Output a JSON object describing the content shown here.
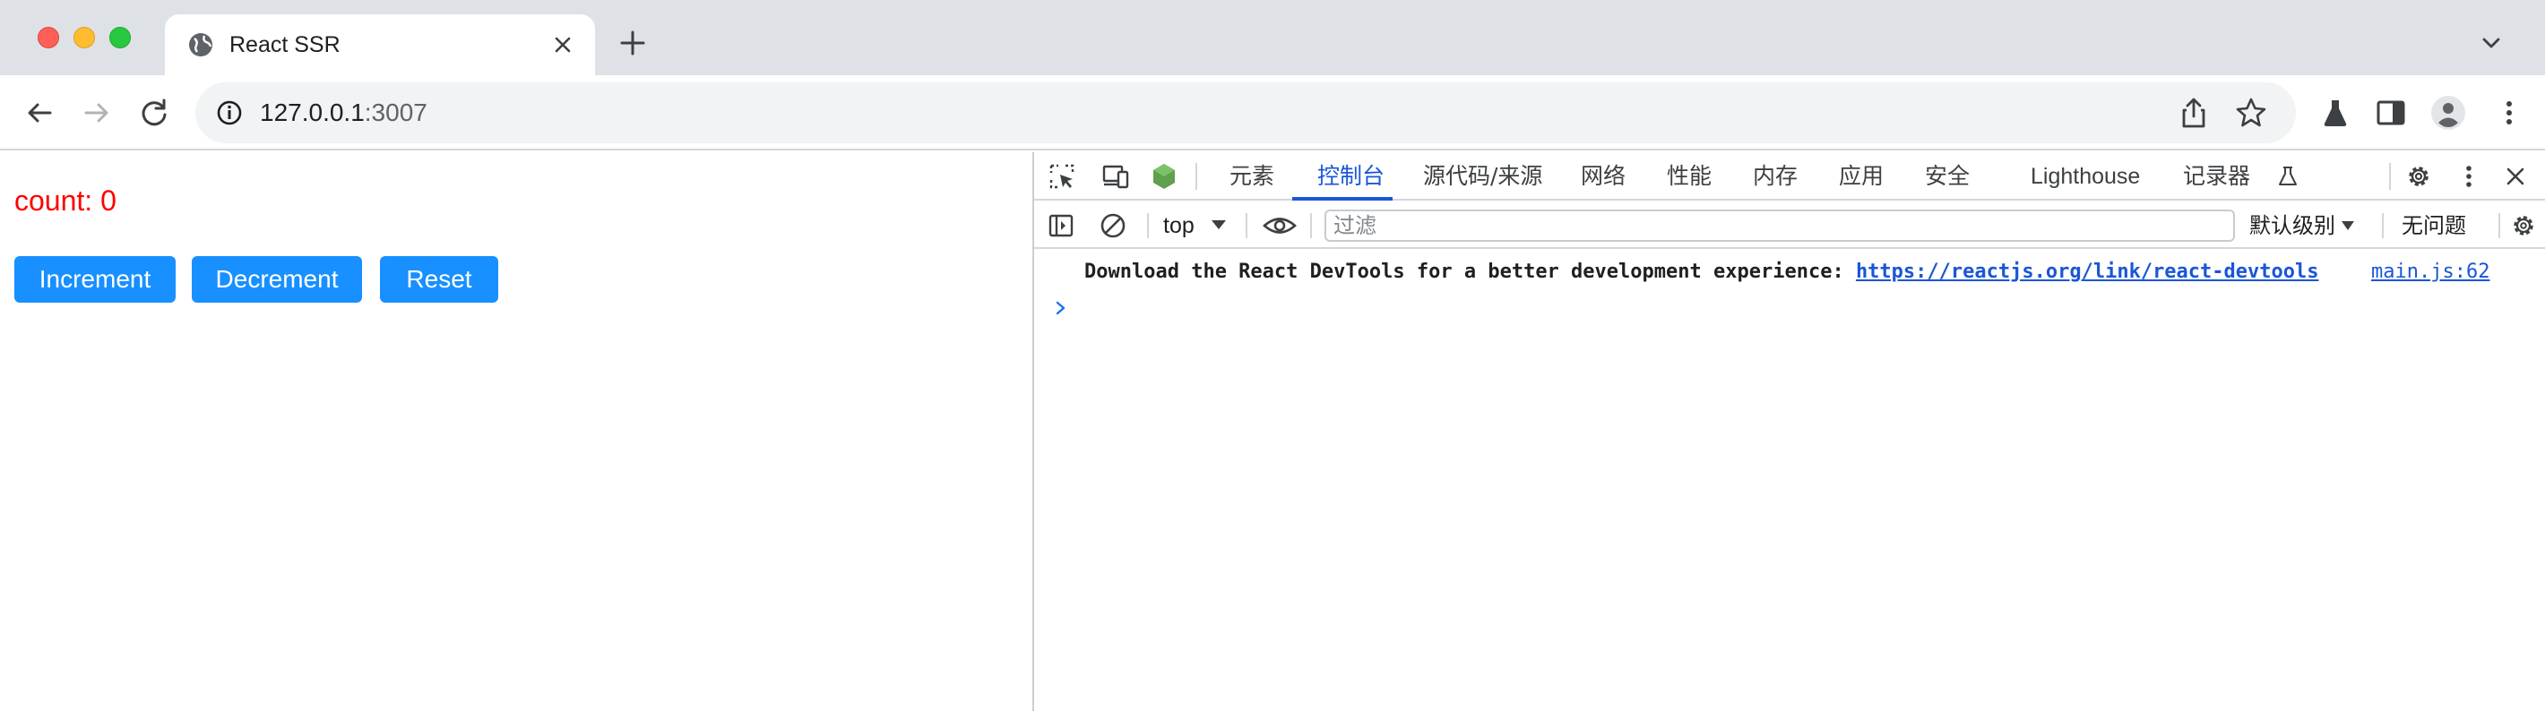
{
  "browser": {
    "tab": {
      "title": "React SSR"
    },
    "url": {
      "host": "127.0.0.1",
      "port": ":3007"
    }
  },
  "page": {
    "count_text": "count: 0",
    "buttons": {
      "increment": "Increment",
      "decrement": "Decrement",
      "reset": "Reset"
    }
  },
  "devtools": {
    "tabs": [
      "元素",
      "控制台",
      "源代码/来源",
      "网络",
      "性能",
      "内存",
      "应用",
      "安全",
      "Lighthouse",
      "记录器"
    ],
    "active_tab": "控制台",
    "console_bar": {
      "context": "top",
      "filter_placeholder": "过滤",
      "levels": "默认级别",
      "issues": "无问题"
    },
    "messages": [
      {
        "text": "Download the React DevTools for a better development experience: ",
        "link": "https://reactjs.org/link/react-devtools",
        "source": "main.js:62"
      }
    ]
  },
  "colors": {
    "button_bg": "#1890ff",
    "count_text": "#ff0000",
    "devtools_accent": "#1a56d6",
    "node_icon": "#5fa04e"
  },
  "icons": {
    "favicon": "globe-icon",
    "tab_close": "close-icon",
    "new_tab": "plus-icon",
    "tab_search": "chevron-down-icon",
    "back": "arrow-left-icon",
    "forward": "arrow-right-icon",
    "reload": "reload-icon",
    "site_info": "info-icon",
    "share": "share-icon",
    "bookmark": "star-icon",
    "labs": "flask-icon",
    "side_panel": "side-panel-icon",
    "profile": "profile-icon",
    "menu": "more-vertical-icon",
    "inspect": "inspect-element-icon",
    "device": "device-toggle-icon",
    "node": "node-js-icon",
    "settings": "gear-icon",
    "close": "close-icon",
    "sidebar_toggle": "sidebar-toggle-icon",
    "clear": "clear-console-icon",
    "live_expression": "eye-icon"
  }
}
